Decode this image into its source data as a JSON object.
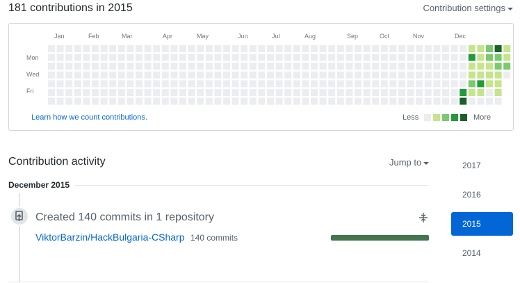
{
  "header": {
    "title": "181 contributions in 2015",
    "settings_label": "Contribution settings"
  },
  "calendar": {
    "months": [
      "Jan",
      "Feb",
      "Mar",
      "Apr",
      "May",
      "Jun",
      "Jul",
      "Aug",
      "Sep",
      "Oct",
      "Nov",
      "Dec"
    ],
    "day_labels": [
      "Mon",
      "Wed",
      "Fri"
    ],
    "learn_link": "Learn how we count contributions.",
    "legend_less": "Less",
    "legend_more": "More",
    "colors": [
      "#ebedf0",
      "#c6e48b",
      "#7bc96f",
      "#239a3b",
      "#196127"
    ],
    "levels": {
      "week_47": [
        0,
        0,
        0,
        0,
        0,
        3,
        4
      ],
      "week_48": [
        1,
        3,
        1,
        1,
        2,
        1,
        0
      ],
      "week_49": [
        1,
        1,
        1,
        1,
        3,
        1,
        0
      ],
      "week_50": [
        2,
        2,
        1,
        1,
        1,
        0,
        0
      ],
      "week_51": [
        4,
        2,
        2,
        1,
        1,
        1,
        0
      ],
      "week_52": [
        1,
        1,
        2,
        0,
        0,
        0,
        0
      ]
    }
  },
  "activity": {
    "title": "Contribution activity",
    "jump_to": "Jump to",
    "month_heading": "December 2015",
    "event_title": "Created 140 commits in 1 repository",
    "repo_name": "ViktorBarzin/HackBulgaria-CSharp",
    "repo_commits": "140 commits",
    "repo_share": 1.0,
    "bar_color": "#44754e"
  },
  "years": [
    "2017",
    "2016",
    "2015",
    "2014"
  ],
  "selected_year": "2015"
}
